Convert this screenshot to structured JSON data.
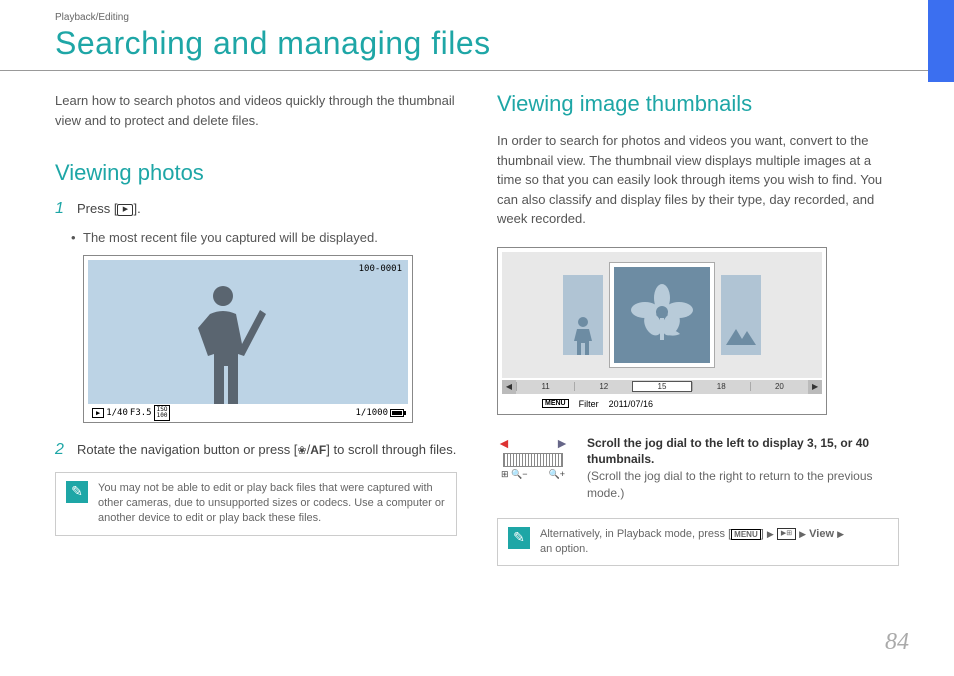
{
  "breadcrumb": "Playback/Editing",
  "title": "Searching and managing files",
  "page_number": "84",
  "left": {
    "intro": "Learn how to search photos and videos quickly through the thumbnail view and to protect and delete files.",
    "section_title": "Viewing photos",
    "step1_num": "1",
    "step1_text_a": "Press [",
    "step1_text_b": "].",
    "bullet1": "The most recent file you captured will be displayed.",
    "screen": {
      "file_number": "100-0001",
      "shutter": "1/40",
      "aperture": "F3.5",
      "iso_label": "ISO",
      "iso_value": "100",
      "speed": "1/1000"
    },
    "step2_num": "2",
    "step2_text_a": "Rotate the navigation button or press [",
    "step2_text_b": "/",
    "step2_af": "AF",
    "step2_text_c": "] to scroll through files.",
    "note": "You may not be able to edit or play back files that were captured with other cameras, due to unsupported sizes or codecs. Use a computer or another device to edit or play back these files."
  },
  "right": {
    "section_title": "Viewing image thumbnails",
    "intro": "In order to search for photos and videos you want, convert to the thumbnail view. The thumbnail view displays multiple images at a time so that you can easily look through items you wish to find. You can also classify and display files by their type, day recorded, and week recorded.",
    "filmstrip": [
      "11",
      "12",
      "15",
      "18",
      "20"
    ],
    "filter_menu": "MENU",
    "filter_label": "Filter",
    "date": "2011/07/16",
    "jog_bold": "Scroll the jog dial to the left to display 3, 15, or 40 thumbnails.",
    "jog_sub": "(Scroll the jog dial to the right to return to the previous mode.)",
    "note_a": "Alternatively, in Playback mode, press [",
    "note_menu": "MENU",
    "note_b": "] ",
    "note_view": "View",
    "note_c": "an option."
  }
}
